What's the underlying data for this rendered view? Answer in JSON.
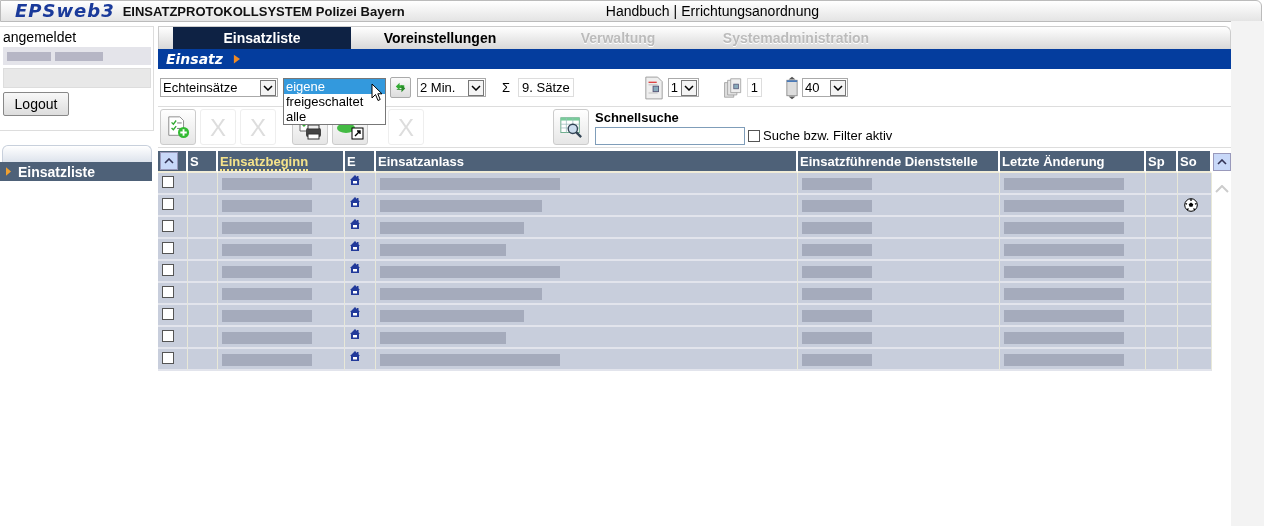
{
  "header": {
    "logo": "EPSweb3",
    "title": "EINSATZPROTOKOLLSYSTEM Polizei Bayern",
    "links": [
      "Handbuch",
      "Errichtungsanordnung"
    ],
    "separator": "|"
  },
  "sidebar": {
    "label": "angemeldet",
    "logout": "Logout",
    "nav": [
      {
        "label": "Einsatzliste",
        "selected": true
      }
    ]
  },
  "tabs": [
    {
      "label": "Einsatzliste",
      "selected": true,
      "disabled": false
    },
    {
      "label": "Voreinstellungen",
      "selected": false,
      "disabled": false
    },
    {
      "label": "Verwaltung",
      "selected": false,
      "disabled": true
    },
    {
      "label": "Systemadministration",
      "selected": false,
      "disabled": true
    }
  ],
  "section_title": "Einsatz",
  "filters": {
    "type": "Echteinsätze",
    "scope_options": [
      {
        "label": "eigene",
        "selected": true
      },
      {
        "label": "freigeschaltet",
        "selected": false
      },
      {
        "label": "alle",
        "selected": false
      }
    ],
    "refresh": "2 Min.",
    "sum_symbol": "Σ",
    "count": "9. Sätze",
    "page": "1",
    "pages": "1",
    "page_size": "40"
  },
  "actions": [
    {
      "kind": "new",
      "disabled": false
    },
    {
      "kind": "delete",
      "label": "X",
      "disabled": true
    },
    {
      "kind": "delete",
      "label": "X",
      "disabled": true
    },
    {
      "kind": "print",
      "disabled": false
    },
    {
      "kind": "export",
      "disabled": false
    },
    {
      "kind": "delete",
      "label": "X",
      "disabled": true
    }
  ],
  "quick_search": {
    "label": "Schnellsuche",
    "filter_label": "Suche bzw. Filter aktiv",
    "filter_checked": false
  },
  "table": {
    "columns": [
      {
        "label": "S",
        "sorted": false
      },
      {
        "label": "Einsatzbeginn",
        "sorted": true
      },
      {
        "label": "E",
        "sorted": false
      },
      {
        "label": "Einsatzanlass",
        "sorted": false
      },
      {
        "label": "Einsatzführende Dienststelle",
        "sorted": false
      },
      {
        "label": "Letzte Änderung",
        "sorted": false
      },
      {
        "label": "Sp",
        "sorted": false
      },
      {
        "label": "So",
        "sorted": false
      }
    ],
    "rows": [
      {
        "checked": false,
        "so_marked": false
      },
      {
        "checked": false,
        "so_marked": true
      },
      {
        "checked": false,
        "so_marked": false
      },
      {
        "checked": false,
        "so_marked": false
      },
      {
        "checked": false,
        "so_marked": false
      },
      {
        "checked": false,
        "so_marked": false
      },
      {
        "checked": false,
        "so_marked": false
      },
      {
        "checked": false,
        "so_marked": false
      },
      {
        "checked": false,
        "so_marked": false
      }
    ]
  }
}
